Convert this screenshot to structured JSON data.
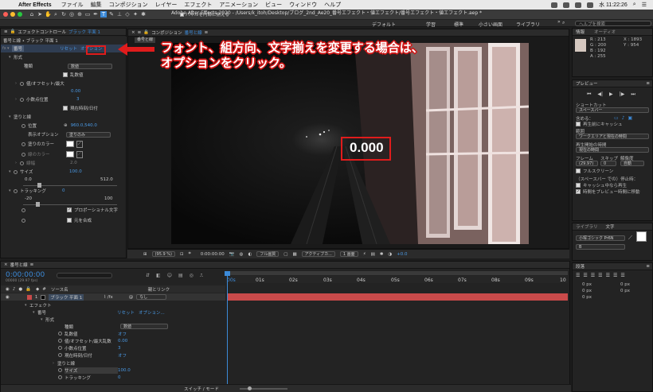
{
  "menubar": {
    "app_name": "After Effects",
    "items": [
      "ファイル",
      "編集",
      "コンポジション",
      "レイヤー",
      "エフェクト",
      "アニメーション",
      "ビュー",
      "ウィンドウ",
      "ヘルプ"
    ],
    "clock": "水 11:22:26"
  },
  "toolbar": {
    "window_title": "Adobe After Effects 2020 - /Users/k_itoh/Desktop/ブログ_2nd_Ae20_番号エフェクト・値エフェクト/番号エフェクト・値エフェクト.aep *",
    "fit_label": "パネルを内部に揃える",
    "workspaces": [
      "デフォルト",
      "学習",
      "標準",
      "小さい画面",
      "ライブラリ"
    ],
    "search_placeholder": "ヘルプを検索"
  },
  "effects_panel": {
    "title": "エフェクトコントロール",
    "layer_name": "ブラック 平面 1",
    "breadcrumb": "番号と線 • ブラック 平面 1",
    "effect_name": "番号",
    "reset_label": "リセット",
    "options_label": "オプション",
    "rows": {
      "format": "形式",
      "type": "種類",
      "type_value": "数値",
      "random": "乱数値",
      "value_offset": "値/オフセット/最大",
      "value_offset_val": "0.00",
      "decimals": "小数点位置",
      "decimals_val": "3",
      "current_time": "現在時刻/日付",
      "fill_stroke": "塗りと線",
      "position": "位置",
      "position_val": "960.0,540.0",
      "display_option": "表示オプション",
      "display_option_val": "塗りのみ",
      "fill_color": "塗りのカラー",
      "stroke_color": "線のカラー",
      "stroke_width": "線幅",
      "stroke_width_val": "2.0",
      "size": "サイズ",
      "size_val": "100.0",
      "size_min": "0.0",
      "size_max": "512.0",
      "tracking": "トラッキング",
      "tracking_val": "0",
      "tracking_min": "-20",
      "tracking_max": "100",
      "proportional": "プロポーショナル文字",
      "composite": "元を合成"
    }
  },
  "composition": {
    "title": "コンポジション",
    "comp_name": "番号と線",
    "tab": "番号と線",
    "number_display": "0.000",
    "zoom": "(95.9 %)",
    "timecode": "0:00:00:00",
    "quality": "フル画質",
    "camera": "アクティブカ...",
    "views": "1 画面",
    "exposure": "+0.0"
  },
  "annotation": {
    "line1": "フォント、組方向、文字揃えを変更する場合は、",
    "line2": "オプションをクリック。"
  },
  "info_panel": {
    "tab1": "情報",
    "tab2": "オーディオ",
    "r": "R : 213",
    "g": "G : 200",
    "b": "B : 192",
    "a": "A : 255",
    "x": "X : 1893",
    "y": "Y : 954"
  },
  "preview_panel": {
    "title": "プレビュー",
    "shortcut_label": "ショートカット",
    "shortcut_val": "スペースバー",
    "include_label": "含める：",
    "cache_before": "再生前にキャッシュ",
    "range_label": "範囲",
    "range_val": "ワークエリアと現在の時間",
    "start_label": "再生開始の時間",
    "start_val": "現在の時間",
    "frames_label": "フレーム",
    "skip_label": "スキップ",
    "resolution_label": "解像度",
    "frames_val": "(29.97)",
    "skip_val": "0",
    "resolution_val": "自動",
    "fullscreen": "フルスクリーン",
    "stop_label": "（スペースバー での）停止時：",
    "cache_until": "キャッシュ中なら再生",
    "move_time": "時間をプレビュー時間に移動"
  },
  "library_panel": {
    "tab1": "ライブラリ",
    "tab2": "文字",
    "font": "小塚ゴシック Pr6N",
    "weight": "B"
  },
  "paragraph_panel": {
    "title": "段落",
    "v1": "0 px",
    "v2": "0 px",
    "v3": "0 px",
    "v4": "0 px",
    "v5": "0 px"
  },
  "timeline": {
    "tab": "番号と線",
    "timecode": "0:00:00:00",
    "frame_info": "00000 (29.97 fps)",
    "col_source": "ソース名",
    "col_parent": "親とリンク",
    "layer_num": "1",
    "layer_name": "ブラック 平面 1",
    "parent_val": "なし",
    "effect": "エフェクト",
    "number": "番号",
    "reset": "リセット",
    "options": "オプション...",
    "format": "形式",
    "type": "種類",
    "type_val": "数値",
    "random": "乱数値",
    "random_val": "オフ",
    "value_offset": "値/オフセット/最大乱数",
    "value_offset_val": "0.00",
    "decimals": "小数点位置",
    "decimals_val": "3",
    "current_time": "現在時刻/日付",
    "current_time_val": "オフ",
    "fill_stroke": "塗りと線",
    "size": "サイズ",
    "size_val": "100.0",
    "tracking": "トラッキング",
    "tracking_val": "0",
    "switch_mode": "スイッチ / モード",
    "ticks": [
      "00s",
      "01s",
      "02s",
      "03s",
      "04s",
      "05s",
      "06s",
      "07s",
      "08s",
      "09s",
      "10"
    ]
  },
  "colors": {
    "accent_blue": "#3c8ad8",
    "annotation_red": "#e01c1c",
    "layer_bar": "#c94a4a"
  }
}
